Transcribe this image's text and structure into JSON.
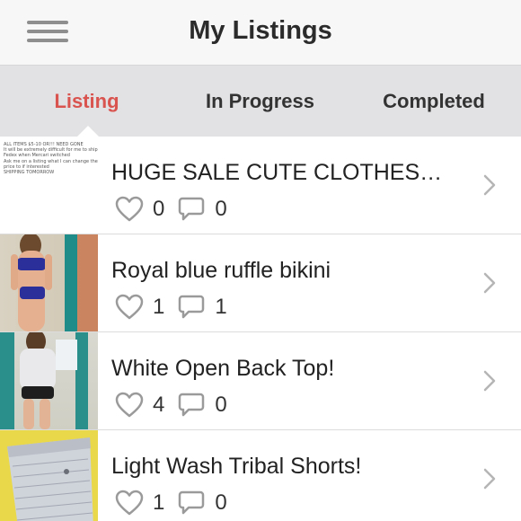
{
  "header": {
    "title": "My Listings",
    "menu_icon": "hamburger-menu-icon"
  },
  "tabs": [
    {
      "label": "Listing",
      "active": true
    },
    {
      "label": "In Progress",
      "active": false
    },
    {
      "label": "Completed",
      "active": false
    }
  ],
  "colors": {
    "accent": "#d9534f",
    "header_bg": "#f7f7f7",
    "tabbar_bg": "#e2e2e4",
    "icon_gray": "#9a9a9a"
  },
  "listings": [
    {
      "title": "HUGE SALE CUTE CLOTHES…",
      "likes": "0",
      "comments": "0",
      "thumb_lines": [
        "ALL ITEMS $5-10 OR!!! NEED GONE",
        "It will be extremely difficult for me to ship with",
        "Fedex when Mercari switched",
        "Ask me on a listing what I can change the",
        "price to if interested",
        "SHIPPING TOMORROW"
      ]
    },
    {
      "title": "Royal blue ruffle bikini",
      "likes": "1",
      "comments": "1"
    },
    {
      "title": "White Open Back Top!",
      "likes": "4",
      "comments": "0"
    },
    {
      "title": "Light Wash Tribal Shorts!",
      "likes": "1",
      "comments": "0"
    }
  ]
}
